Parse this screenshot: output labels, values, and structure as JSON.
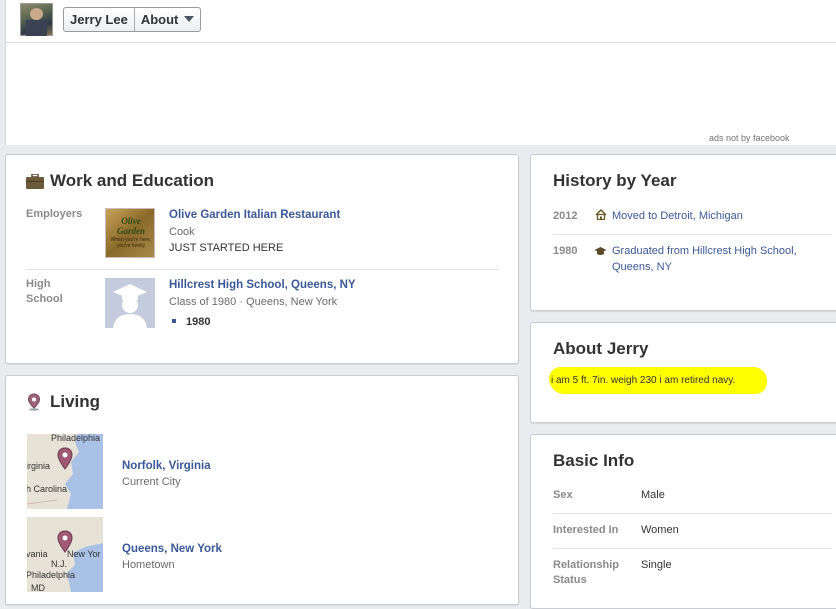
{
  "header": {
    "profile_name": "Jerry Lee",
    "section": "About",
    "ads_notice": "ads not by facebook"
  },
  "work_education": {
    "title": "Work and Education",
    "employers_label": "Employers",
    "employer": {
      "name": "Olive Garden Italian Restaurant",
      "position": "Cook",
      "description": "JUST STARTED HERE",
      "logo_text": "Olive Garden",
      "logo_sub": "When you're here, you're family"
    },
    "high_school_label": "High School",
    "school": {
      "name": "Hillcrest High School, Queens, NY",
      "details": "Class of 1980 · Queens, New York",
      "year": "1980"
    }
  },
  "living": {
    "title": "Living",
    "places": [
      {
        "name": "Norfolk, Virginia",
        "type": "Current City",
        "map_labels": [
          "Philadelphia",
          "irginia",
          "h Carolina"
        ]
      },
      {
        "name": "Queens, New York",
        "type": "Hometown",
        "map_labels": [
          "New Yor",
          "vania",
          "N.J.",
          "Philadelphia",
          "MD"
        ]
      }
    ]
  },
  "history": {
    "title": "History by Year",
    "events": [
      {
        "year": "2012",
        "icon": "home-icon",
        "text": "Moved to Detroit, Michigan"
      },
      {
        "year": "1980",
        "icon": "graduation-cap-icon",
        "text": "Graduated from Hillcrest High School, Queens, NY"
      }
    ]
  },
  "about": {
    "title": "About Jerry",
    "text": "i am 5 ft. 7in. weigh 230 i am retired navy.",
    "highlight_color": "#ffff00"
  },
  "basic_info": {
    "title": "Basic Info",
    "rows": [
      {
        "label": "Sex",
        "value": "Male"
      },
      {
        "label": "Interested In",
        "value": "Women"
      },
      {
        "label": "Relationship Status",
        "value": "Single"
      }
    ]
  },
  "colors": {
    "link": "#3b5998",
    "label": "#8a8a8a",
    "background": "#e9ebee"
  }
}
